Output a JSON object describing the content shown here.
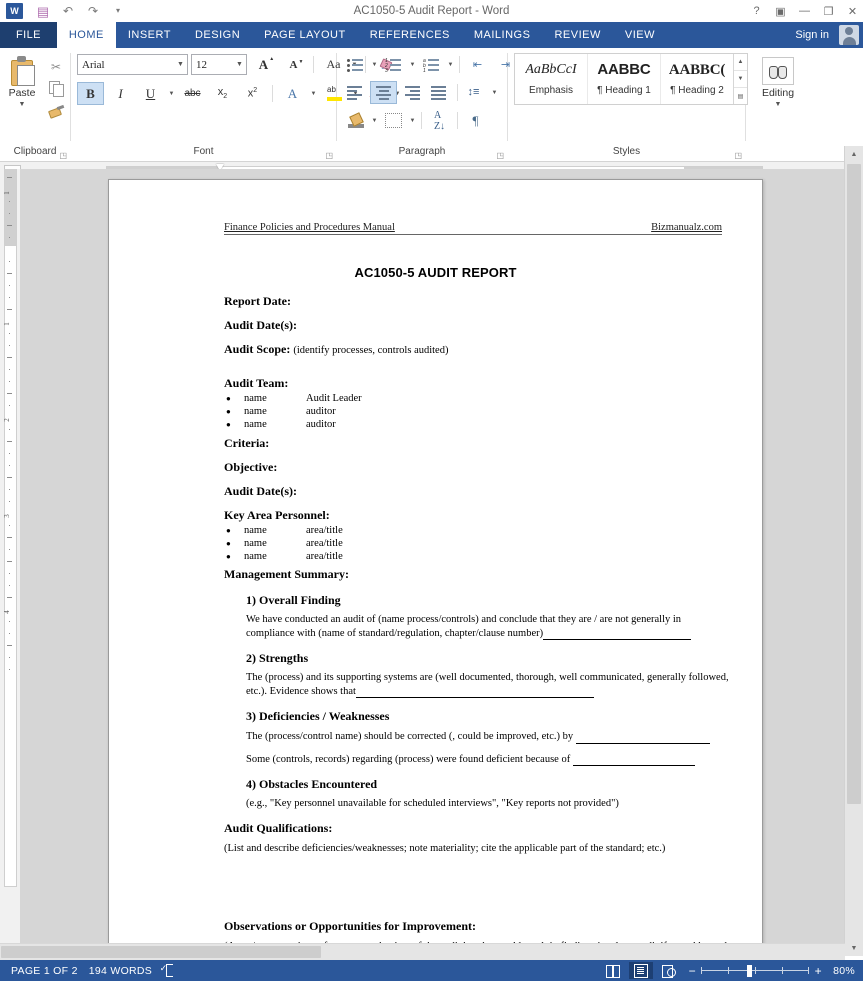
{
  "window": {
    "title": "AC1050-5 Audit Report - Word",
    "quick_access": [
      "save-icon",
      "undo-icon",
      "redo-icon",
      "customize-icon"
    ],
    "controls": {
      "help": "?",
      "ribbon_display": "▣",
      "minimize": "—",
      "restore": "❐",
      "close": "✕"
    },
    "sign_in": "Sign in"
  },
  "ribbon": {
    "tabs": [
      {
        "label": "FILE",
        "active": false
      },
      {
        "label": "HOME",
        "active": true
      },
      {
        "label": "INSERT",
        "active": false
      },
      {
        "label": "DESIGN",
        "active": false
      },
      {
        "label": "PAGE LAYOUT",
        "active": false
      },
      {
        "label": "REFERENCES",
        "active": false
      },
      {
        "label": "MAILINGS",
        "active": false
      },
      {
        "label": "REVIEW",
        "active": false
      },
      {
        "label": "VIEW",
        "active": false
      }
    ],
    "clipboard": {
      "group_label": "Clipboard",
      "paste_label": "Paste",
      "cut_label": "✂",
      "copy_label": "Copy",
      "format_painter_label": "Format Painter"
    },
    "font": {
      "group_label": "Font",
      "font_name": "Arial",
      "font_size": "12",
      "grow_label": "A",
      "shrink_label": "A",
      "change_case_label": "Aa",
      "clear_formatting_label": "A",
      "bold_label": "B",
      "italic_label": "I",
      "underline_label": "U",
      "strikethrough_label": "abc",
      "subscript_label": "x",
      "superscript_label": "x",
      "bold_active": true
    },
    "paragraph": {
      "group_label": "Paragraph",
      "center_active": true
    },
    "styles": {
      "group_label": "Styles",
      "items": [
        {
          "preview": "AaBbCcI",
          "name": "Emphasis"
        },
        {
          "preview": "AABBC",
          "name": "¶ Heading 1"
        },
        {
          "preview": "AABBC(",
          "name": "¶ Heading 2"
        }
      ]
    },
    "editing": {
      "group_label": "Editing",
      "label": "Editing"
    }
  },
  "ruler": {
    "tab_selector": "L",
    "h_ticks": [
      "1",
      "1",
      "2"
    ],
    "v_ticks": [
      "1",
      "2",
      "3",
      "4"
    ]
  },
  "document": {
    "header_left": "Finance Policies and Procedures Manual",
    "header_right": "Bizmanualz.com",
    "title": "AC1050-5 AUDIT REPORT",
    "fields": [
      {
        "label": "Report Date:",
        "note": ""
      },
      {
        "label": "Audit Date(s):",
        "note": ""
      },
      {
        "label": "Audit Scope:",
        "note": "(identify processes, controls audited)"
      }
    ],
    "audit_team_label": "Audit Team:",
    "audit_team": [
      {
        "name": "name",
        "role": "Audit Leader"
      },
      {
        "name": "name",
        "role": "auditor"
      },
      {
        "name": "name",
        "role": "auditor"
      }
    ],
    "fields2": [
      {
        "label": "Criteria:",
        "note": ""
      },
      {
        "label": "Objective:",
        "note": ""
      },
      {
        "label": "Audit Date(s):",
        "note": ""
      }
    ],
    "key_area_label": "Key Area Personnel:",
    "key_area": [
      {
        "name": "name",
        "role": "area/title"
      },
      {
        "name": "name",
        "role": "area/title"
      },
      {
        "name": "name",
        "role": "area/title"
      }
    ],
    "management_summary_label": "Management Summary:",
    "summary_sections": [
      {
        "heading": "1) Overall Finding",
        "paragraphs": [
          "We have conducted an audit of (name process/controls) and conclude that they are / are not generally in compliance with (name of standard/regulation, chapter/clause number)"
        ]
      },
      {
        "heading": "2) Strengths",
        "paragraphs": [
          "The (process) and its supporting systems are (well documented, thorough, well communicated, generally followed, etc.).  Evidence shows that"
        ]
      },
      {
        "heading": "3) Deficiencies / Weaknesses",
        "paragraphs": [
          "The (process/control name) should be corrected (, could be improved, etc.) by",
          "Some (controls, records) regarding (process) were found deficient because of"
        ]
      },
      {
        "heading": "4) Obstacles Encountered",
        "paragraphs": [
          "(e.g., \"Key personnel unavailable for scheduled interviews\", \"Key reports not provided\")"
        ]
      }
    ],
    "audit_qualifications_label": "Audit Qualifications:",
    "audit_qualifications_text": "(List and describe deficiencies/weaknesses; note materiality; cite the applicable part of the standard; etc.)",
    "observations_label": "Observations or Opportunities for Improvement:",
    "observations_text": "(Areas/processes in conformance at the time of the audit but that could result in findings in a later audit if not addressed by the Company.)"
  },
  "status": {
    "page": "PAGE 1 OF 2",
    "words": "194 WORDS",
    "proofing_icon": "proofing-errors-icon",
    "views": [
      {
        "name": "read-mode",
        "active": false
      },
      {
        "name": "print-layout",
        "active": true
      },
      {
        "name": "web-layout",
        "active": false
      }
    ],
    "zoom_out": "−",
    "zoom_in": "+",
    "zoom_level": "80%"
  }
}
